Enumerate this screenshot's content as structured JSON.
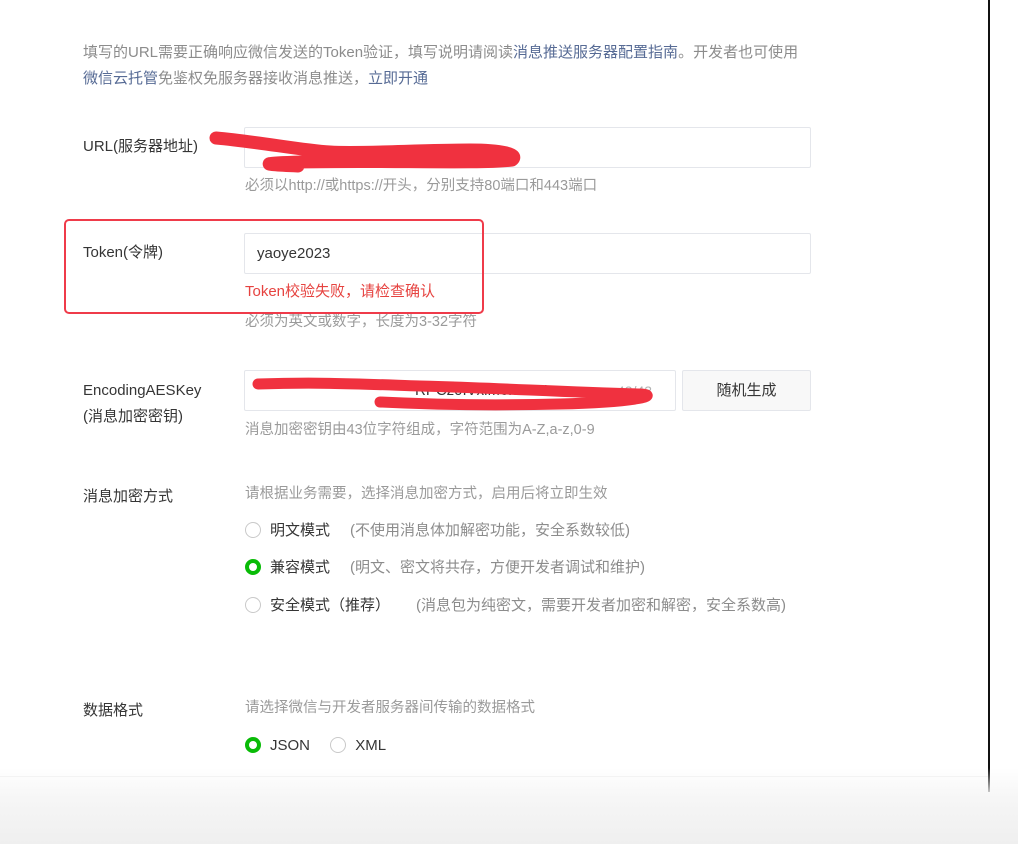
{
  "intro": {
    "line1_pre": "填写的URL需要正确响应微信发送的Token验证，填写说明请阅读",
    "guide_link": "消息推送服务器配置指南",
    "line1_post": "。开发者也可使用",
    "cloud_link": "微信云托管",
    "line2_mid": "免鉴权免服务器接收消息推送，",
    "open_link": "立即开通"
  },
  "url": {
    "label": "URL(服务器地址)",
    "tip": "必须以http://或https://开头，分别支持80端口和443端口"
  },
  "token": {
    "label": "Token(令牌)",
    "value": "yaoye2023",
    "error": "Token校验失败，请检查确认",
    "tip": "必须为英文或数字，长度为3-32字符"
  },
  "aes": {
    "label_line1": "EncodingAESKey",
    "label_line2": "(消息加密密钥)",
    "value_visible": "RPCz0IVxlM6h3ON",
    "counter": "43/43",
    "random_button": "随机生成",
    "tip": "消息加密密钥由43位字符组成，字符范围为A-Z,a-z,0-9"
  },
  "encrypt": {
    "label": "消息加密方式",
    "tip": "请根据业务需要，选择消息加密方式，启用后将立即生效",
    "options": [
      {
        "name": "明文模式",
        "desc": "(不使用消息体加解密功能，安全系数较低)",
        "checked": false
      },
      {
        "name": "兼容模式",
        "desc": "(明文、密文将共存，方便开发者调试和维护)",
        "checked": true
      },
      {
        "name": "安全模式（推荐）",
        "desc": "(消息包为纯密文，需要开发者加密和解密，安全系数高)",
        "checked": false
      }
    ]
  },
  "format": {
    "label": "数据格式",
    "tip": "请选择微信与开发者服务器间传输的数据格式",
    "options": [
      {
        "name": "JSON",
        "checked": true
      },
      {
        "name": "XML",
        "checked": false
      }
    ]
  },
  "colors": {
    "link": "#576b95",
    "error": "#e64340",
    "radio_checked": "#09bb07",
    "annotation_red": "#ef3b4a"
  }
}
